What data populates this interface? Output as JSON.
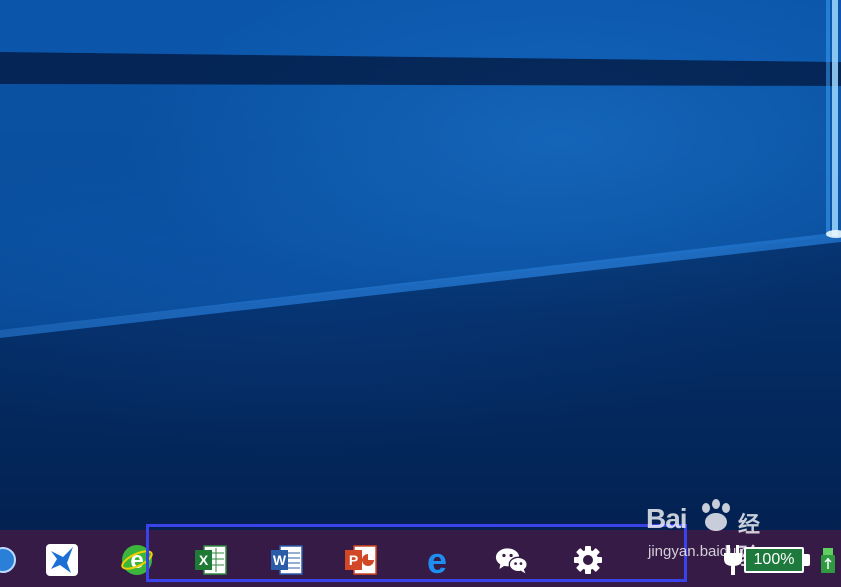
{
  "desktop": {
    "wallpaper": "windows-10-hero-light-beams"
  },
  "taskbar": {
    "background": "#351b46",
    "pinned": [
      {
        "name": "start-orb-icon"
      },
      {
        "name": "feiyu-bird-icon"
      },
      {
        "name": "browser-e-green-icon"
      },
      {
        "name": "excel-icon",
        "glyph": "X"
      },
      {
        "name": "word-icon",
        "glyph": "W"
      },
      {
        "name": "powerpoint-icon",
        "glyph": "P"
      },
      {
        "name": "edge-icon",
        "glyph": "e"
      },
      {
        "name": "wechat-icon"
      },
      {
        "name": "settings-gear-icon"
      }
    ],
    "highlight_color": "#3a42ea"
  },
  "tray": {
    "battery_percent": "100%",
    "battery_color": "#1e7a3c"
  },
  "watermark": {
    "brand": "Bai",
    "cn": "经验",
    "url": "jingyan.baidu.com"
  }
}
